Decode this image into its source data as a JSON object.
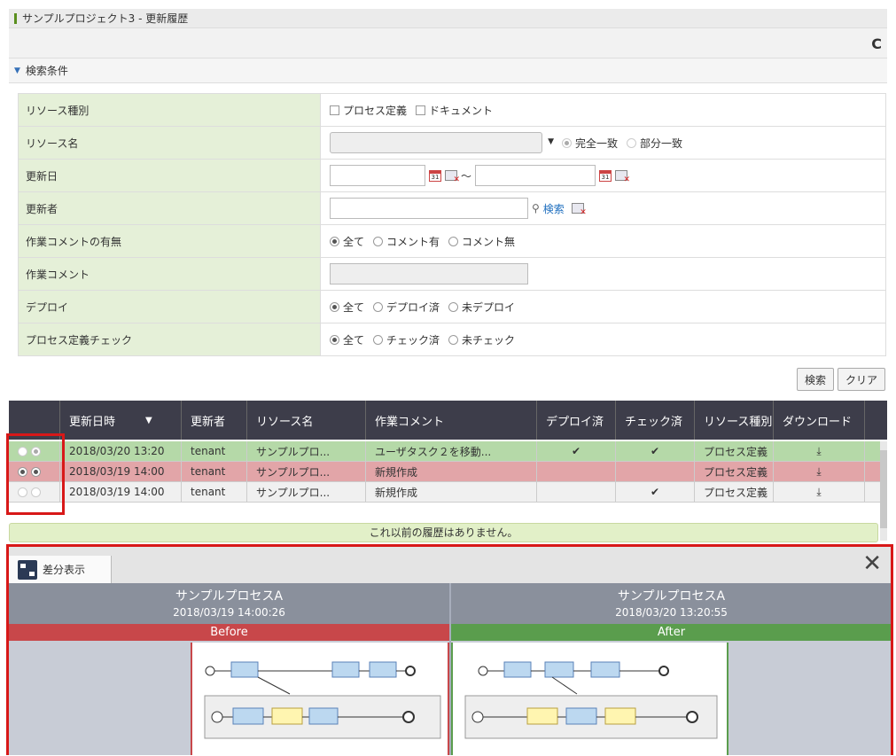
{
  "window": {
    "title": "サンプルプロジェクト3 - 更新履歴",
    "refresh_icon": "C"
  },
  "section": {
    "title": "検索条件"
  },
  "form": {
    "resource_type": {
      "label": "リソース種別",
      "opt1": "プロセス定義",
      "opt2": "ドキュメント"
    },
    "resource_name": {
      "label": "リソース名",
      "opt1": "完全一致",
      "opt2": "部分一致"
    },
    "update_date": {
      "label": "更新日",
      "tilde": "～",
      "cal_text": "31"
    },
    "updater": {
      "label": "更新者",
      "search_link": "検索"
    },
    "comment_presence": {
      "label": "作業コメントの有無",
      "opt1": "全て",
      "opt2": "コメント有",
      "opt3": "コメント無"
    },
    "comment": {
      "label": "作業コメント"
    },
    "deploy": {
      "label": "デプロイ",
      "opt1": "全て",
      "opt2": "デプロイ済",
      "opt3": "未デプロイ"
    },
    "check": {
      "label": "プロセス定義チェック",
      "opt1": "全て",
      "opt2": "チェック済",
      "opt3": "未チェック"
    }
  },
  "buttons": {
    "search": "検索",
    "clear": "クリア"
  },
  "grid": {
    "headers": [
      "",
      "更新日時",
      "更新者",
      "リソース名",
      "作業コメント",
      "デプロイ済",
      "チェック済",
      "リソース種別",
      "ダウンロード"
    ],
    "sort_icon": "▼",
    "rows": [
      {
        "datetime": "2018/03/20 13:20",
        "user": "tenant",
        "resource": "サンプルプロ...",
        "comment": "ユーザタスク２を移動...",
        "deployed": "✔",
        "checked": "✔",
        "type": "プロセス定義",
        "download": "⤓"
      },
      {
        "datetime": "2018/03/19 14:00",
        "user": "tenant",
        "resource": "サンプルプロ...",
        "comment": "新規作成",
        "deployed": "",
        "checked": "",
        "type": "プロセス定義",
        "download": "⤓"
      },
      {
        "datetime": "2018/03/19 14:00",
        "user": "tenant",
        "resource": "サンプルプロ...",
        "comment": "新規作成",
        "deployed": "",
        "checked": "✔",
        "type": "プロセス定義",
        "download": "⤓"
      }
    ],
    "no_more": "これ以前の履歴はありません。"
  },
  "diff": {
    "tab_label": "差分表示",
    "close": "✕",
    "before": {
      "title": "サンプルプロセスA",
      "date": "2018/03/19 14:00:26",
      "label": "Before"
    },
    "after": {
      "title": "サンプルプロセスA",
      "date": "2018/03/20 13:20:55",
      "label": "After"
    }
  }
}
